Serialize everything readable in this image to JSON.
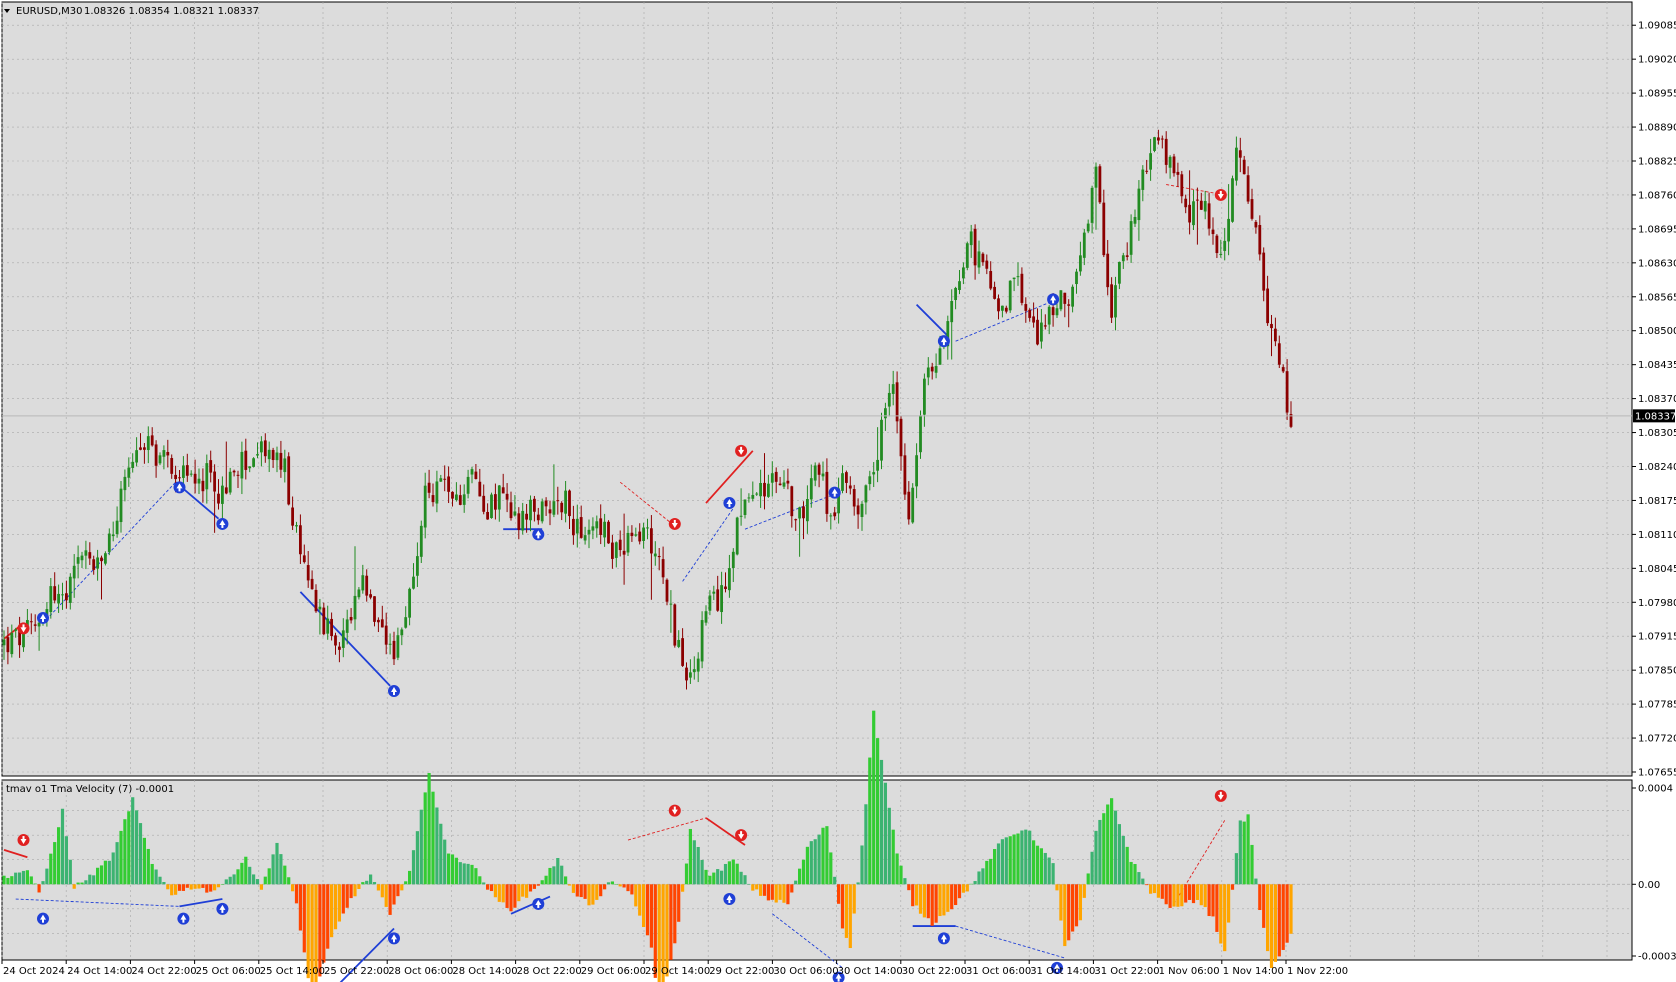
{
  "header": {
    "symbol": "EURUSD,M30",
    "ohlc": "1.08326 1.08354 1.08321 1.08337"
  },
  "colors": {
    "background": "#dcdcdc",
    "grid": "#a9a9a9",
    "bull": "#228b22",
    "bear": "#8b0000",
    "signal_up": "#1f3fd6",
    "signal_down": "#e02020",
    "hist_green_bright": "#33cc33",
    "hist_green_dark": "#3cb371",
    "hist_orange": "#ffa500",
    "hist_red": "#ff4500",
    "price_label_bg": "#000000"
  },
  "chart_data": [
    {
      "type": "candlestick",
      "title": "EURUSD,M30",
      "ylim": [
        1.07655,
        1.09095
      ],
      "y_ticks": [
        "1.09085",
        "1.09020",
        "1.08955",
        "1.08890",
        "1.08825",
        "1.08760",
        "1.08695",
        "1.08630",
        "1.08565",
        "1.08500",
        "1.08435",
        "1.08370",
        "1.08305",
        "1.08240",
        "1.08175",
        "1.08110",
        "1.08045",
        "1.07980",
        "1.07915",
        "1.07850",
        "1.07785",
        "1.07720",
        "1.07655"
      ],
      "x_labels": [
        "24 Oct 2024",
        "24 Oct 14:00",
        "24 Oct 22:00",
        "25 Oct 06:00",
        "25 Oct 14:00",
        "25 Oct 22:00",
        "28 Oct 06:00",
        "28 Oct 14:00",
        "28 Oct 22:00",
        "29 Oct 06:00",
        "29 Oct 14:00",
        "29 Oct 22:00",
        "30 Oct 06:00",
        "30 Oct 14:00",
        "30 Oct 22:00",
        "31 Oct 06:00",
        "31 Oct 14:00",
        "31 Oct 22:00",
        "1 Nov 06:00",
        "1 Nov 14:00",
        "1 Nov 22:00"
      ],
      "last_price": "1.08337",
      "close_path": [
        [
          0,
          1.079
        ],
        [
          4,
          1.0791
        ],
        [
          8,
          1.0793
        ],
        [
          12,
          1.08
        ],
        [
          16,
          1.0798
        ],
        [
          20,
          1.0808
        ],
        [
          24,
          1.0804
        ],
        [
          28,
          1.0812
        ],
        [
          32,
          1.0824
        ],
        [
          36,
          1.0829
        ],
        [
          40,
          1.0826
        ],
        [
          44,
          1.0824
        ],
        [
          48,
          1.0821
        ],
        [
          52,
          1.0822
        ],
        [
          56,
          1.0818
        ],
        [
          60,
          1.0824
        ],
        [
          64,
          1.0826
        ],
        [
          68,
          1.0827
        ],
        [
          72,
          1.0823
        ],
        [
          76,
          1.0806
        ],
        [
          80,
          1.0799
        ],
        [
          84,
          1.079
        ],
        [
          88,
          1.0793
        ],
        [
          92,
          1.0801
        ],
        [
          96,
          1.0792
        ],
        [
          100,
          1.0786
        ],
        [
          104,
          1.08
        ],
        [
          108,
          1.0818
        ],
        [
          112,
          1.0821
        ],
        [
          116,
          1.0817
        ],
        [
          120,
          1.0823
        ],
        [
          124,
          1.0816
        ],
        [
          128,
          1.0819
        ],
        [
          132,
          1.0812
        ],
        [
          136,
          1.0816
        ],
        [
          140,
          1.0814
        ],
        [
          144,
          1.0818
        ],
        [
          148,
          1.0809
        ],
        [
          152,
          1.0814
        ],
        [
          156,
          1.0808
        ],
        [
          160,
          1.0809
        ],
        [
          164,
          1.0812
        ],
        [
          168,
          1.0807
        ],
        [
          172,
          1.0792
        ],
        [
          176,
          1.0782
        ],
        [
          180,
          1.0796
        ],
        [
          184,
          1.0799
        ],
        [
          188,
          1.0814
        ],
        [
          192,
          1.0818
        ],
        [
          196,
          1.0822
        ],
        [
          200,
          1.082
        ],
        [
          204,
          1.0814
        ],
        [
          208,
          1.0825
        ],
        [
          212,
          1.0815
        ],
        [
          216,
          1.0822
        ],
        [
          220,
          1.0815
        ],
        [
          224,
          1.0828
        ],
        [
          228,
          1.084
        ],
        [
          232,
          1.0815
        ],
        [
          236,
          1.084
        ],
        [
          240,
          1.0845
        ],
        [
          244,
          1.0859
        ],
        [
          248,
          1.0867
        ],
        [
          252,
          1.086
        ],
        [
          256,
          1.0855
        ],
        [
          260,
          1.0859
        ],
        [
          264,
          1.0849
        ],
        [
          268,
          1.0853
        ],
        [
          272,
          1.0856
        ],
        [
          276,
          1.0862
        ],
        [
          280,
          1.0879
        ],
        [
          284,
          1.0855
        ],
        [
          288,
          1.0866
        ],
        [
          292,
          1.0881
        ],
        [
          296,
          1.0886
        ],
        [
          300,
          1.088
        ],
        [
          304,
          1.0872
        ],
        [
          308,
          1.0875
        ],
        [
          312,
          1.0862
        ],
        [
          316,
          1.0884
        ],
        [
          320,
          1.0872
        ],
        [
          324,
          1.0853
        ],
        [
          328,
          1.084
        ],
        [
          330,
          1.0833
        ]
      ],
      "overlay_lines": [
        {
          "kind": "solid",
          "color": "signal_down",
          "points": [
            [
              0,
              1.0791
            ],
            [
              5,
              1.0794
            ]
          ]
        },
        {
          "kind": "dashed",
          "color": "signal_up",
          "points": [
            [
              10,
              1.0794
            ],
            [
              44,
              1.0821
            ]
          ]
        },
        {
          "kind": "solid",
          "color": "signal_up",
          "points": [
            [
              44,
              1.0821
            ],
            [
              55,
              1.0814
            ]
          ]
        },
        {
          "kind": "solid",
          "color": "signal_up",
          "points": [
            [
              76,
              1.08
            ],
            [
              99,
              1.0782
            ]
          ]
        },
        {
          "kind": "solid",
          "color": "signal_up",
          "points": [
            [
              128,
              1.0812
            ],
            [
              138,
              1.0812
            ]
          ]
        },
        {
          "kind": "dashed",
          "color": "signal_down",
          "points": [
            [
              158,
              1.0821
            ],
            [
              173,
              1.0812
            ]
          ]
        },
        {
          "kind": "dashed",
          "color": "signal_up",
          "points": [
            [
              174,
              1.0802
            ],
            [
              187,
              1.0816
            ]
          ]
        },
        {
          "kind": "solid",
          "color": "signal_down",
          "points": [
            [
              180,
              1.0817
            ],
            [
              192,
              1.0827
            ]
          ]
        },
        {
          "kind": "dashed",
          "color": "signal_up",
          "points": [
            [
              190,
              1.0812
            ],
            [
              214,
              1.0819
            ]
          ]
        },
        {
          "kind": "solid",
          "color": "signal_up",
          "points": [
            [
              234,
              1.0855
            ],
            [
              242,
              1.0849
            ]
          ]
        },
        {
          "kind": "dashed",
          "color": "signal_up",
          "points": [
            [
              244,
              1.0848
            ],
            [
              270,
              1.0856
            ]
          ]
        },
        {
          "kind": "dashed",
          "color": "signal_down",
          "points": [
            [
              298,
              1.0878
            ],
            [
              313,
              1.0876
            ]
          ]
        }
      ],
      "arrows": [
        {
          "i": 5,
          "price": 1.0793,
          "dir": "down"
        },
        {
          "i": 10,
          "price": 1.0795,
          "dir": "up"
        },
        {
          "i": 45,
          "price": 1.082,
          "dir": "up"
        },
        {
          "i": 56,
          "price": 1.0813,
          "dir": "up"
        },
        {
          "i": 100,
          "price": 1.0781,
          "dir": "up"
        },
        {
          "i": 137,
          "price": 1.0811,
          "dir": "up"
        },
        {
          "i": 172,
          "price": 1.0813,
          "dir": "down"
        },
        {
          "i": 186,
          "price": 1.0817,
          "dir": "up"
        },
        {
          "i": 189,
          "price": 1.0827,
          "dir": "down"
        },
        {
          "i": 213,
          "price": 1.0819,
          "dir": "up"
        },
        {
          "i": 241,
          "price": 1.0848,
          "dir": "up"
        },
        {
          "i": 269,
          "price": 1.0856,
          "dir": "up"
        },
        {
          "i": 312,
          "price": 1.0876,
          "dir": "down"
        }
      ]
    },
    {
      "type": "bar",
      "title": "tmav o1 Tma Velocity (7) -0.0001",
      "ylim": [
        -0.0003,
        0.0004
      ],
      "y_ticks": [
        "0.0004",
        "0.00",
        "-0.0003"
      ],
      "values_path": [
        [
          0,
          3e-05
        ],
        [
          6,
          6e-05
        ],
        [
          9,
          -4e-05
        ],
        [
          12,
          0.00012
        ],
        [
          15,
          0.0003
        ],
        [
          18,
          -1e-05
        ],
        [
          22,
          3e-05
        ],
        [
          28,
          0.00012
        ],
        [
          33,
          0.00035
        ],
        [
          38,
          8e-05
        ],
        [
          43,
          -4e-05
        ],
        [
          49,
          -1e-05
        ],
        [
          53,
          -3e-05
        ],
        [
          57,
          1e-05
        ],
        [
          62,
          0.00011
        ],
        [
          66,
          -2e-05
        ],
        [
          70,
          0.00017
        ],
        [
          75,
          -8e-05
        ],
        [
          79,
          -0.00048
        ],
        [
          84,
          -0.00022
        ],
        [
          89,
          -6e-05
        ],
        [
          94,
          4e-05
        ],
        [
          99,
          -0.00013
        ],
        [
          104,
          6e-05
        ],
        [
          109,
          0.00045
        ],
        [
          114,
          0.00012
        ],
        [
          120,
          8e-05
        ],
        [
          126,
          -6e-05
        ],
        [
          130,
          -0.0001
        ],
        [
          136,
          -2e-05
        ],
        [
          142,
          0.0001
        ],
        [
          146,
          -3e-05
        ],
        [
          151,
          -9e-05
        ],
        [
          156,
          2e-05
        ],
        [
          161,
          -5e-05
        ],
        [
          166,
          -0.00025
        ],
        [
          168,
          -0.00052
        ],
        [
          173,
          -0.00016
        ],
        [
          176,
          0.00022
        ],
        [
          181,
          3e-05
        ],
        [
          187,
          0.0001
        ],
        [
          192,
          -2e-05
        ],
        [
          196,
          -6e-05
        ],
        [
          201,
          -8e-05
        ],
        [
          206,
          0.00015
        ],
        [
          211,
          0.00024
        ],
        [
          215,
          -0.00018
        ],
        [
          217,
          -0.00025
        ],
        [
          220,
          0.00015
        ],
        [
          223,
          0.0007
        ],
        [
          229,
          0.00012
        ],
        [
          233,
          -8e-05
        ],
        [
          238,
          -0.00016
        ],
        [
          244,
          -8e-05
        ],
        [
          249,
          2e-05
        ],
        [
          256,
          0.00018
        ],
        [
          262,
          0.00023
        ],
        [
          269,
          8e-05
        ],
        [
          272,
          -0.00025
        ],
        [
          276,
          -0.00015
        ],
        [
          280,
          0.00022
        ],
        [
          284,
          0.00035
        ],
        [
          289,
          0.0001
        ],
        [
          294,
          -3e-05
        ],
        [
          300,
          -0.0001
        ],
        [
          306,
          -6e-05
        ],
        [
          310,
          -0.00014
        ],
        [
          313,
          -0.00028
        ],
        [
          317,
          0.00025
        ],
        [
          319,
          0.00028
        ],
        [
          322,
          -0.0001
        ],
        [
          325,
          -0.00035
        ],
        [
          329,
          -0.00023
        ],
        [
          330,
          -0.0002
        ]
      ],
      "overlay_lines": [
        {
          "kind": "solid",
          "color": "signal_down",
          "points": [
            [
              0,
              0.00014
            ],
            [
              6,
              0.00011
            ]
          ]
        },
        {
          "kind": "dashed",
          "color": "signal_up",
          "points": [
            [
              3,
              -6e-05
            ],
            [
              45,
              -9e-05
            ]
          ]
        },
        {
          "kind": "solid",
          "color": "signal_up",
          "points": [
            [
              45,
              -9e-05
            ],
            [
              56,
              -6e-05
            ]
          ]
        },
        {
          "kind": "solid",
          "color": "signal_up",
          "points": [
            [
              80,
              -0.0005
            ],
            [
              100,
              -0.00018
            ]
          ]
        },
        {
          "kind": "solid",
          "color": "signal_up",
          "points": [
            [
              130,
              -0.00012
            ],
            [
              140,
              -5e-05
            ]
          ]
        },
        {
          "kind": "dashed",
          "color": "signal_down",
          "points": [
            [
              160,
              0.00018
            ],
            [
              180,
              0.00027
            ]
          ]
        },
        {
          "kind": "solid",
          "color": "signal_down",
          "points": [
            [
              180,
              0.00027
            ],
            [
              190,
              0.00016
            ]
          ]
        },
        {
          "kind": "dashed",
          "color": "signal_up",
          "points": [
            [
              197,
              -0.00012
            ],
            [
              215,
              -0.00034
            ]
          ]
        },
        {
          "kind": "solid",
          "color": "signal_up",
          "points": [
            [
              233,
              -0.00017
            ],
            [
              244,
              -0.00017
            ]
          ]
        },
        {
          "kind": "dashed",
          "color": "signal_up",
          "points": [
            [
              244,
              -0.00017
            ],
            [
              272,
              -0.0003
            ]
          ]
        },
        {
          "kind": "dashed",
          "color": "signal_down",
          "points": [
            [
              300,
              -8e-05
            ],
            [
              313,
              0.00026
            ]
          ]
        }
      ],
      "arrows": [
        {
          "i": 5,
          "value": 0.00018,
          "dir": "down"
        },
        {
          "i": 10,
          "value": -0.00014,
          "dir": "up"
        },
        {
          "i": 46,
          "value": -0.00014,
          "dir": "up"
        },
        {
          "i": 56,
          "value": -0.0001,
          "dir": "up"
        },
        {
          "i": 100,
          "value": -0.00022,
          "dir": "up"
        },
        {
          "i": 137,
          "value": -8e-05,
          "dir": "up"
        },
        {
          "i": 172,
          "value": 0.0003,
          "dir": "down"
        },
        {
          "i": 186,
          "value": -6e-05,
          "dir": "up"
        },
        {
          "i": 189,
          "value": 0.0002,
          "dir": "down"
        },
        {
          "i": 214,
          "value": -0.00038,
          "dir": "up"
        },
        {
          "i": 241,
          "value": -0.00022,
          "dir": "up"
        },
        {
          "i": 270,
          "value": -0.00034,
          "dir": "up"
        },
        {
          "i": 312,
          "value": 0.00036,
          "dir": "down"
        }
      ]
    }
  ]
}
